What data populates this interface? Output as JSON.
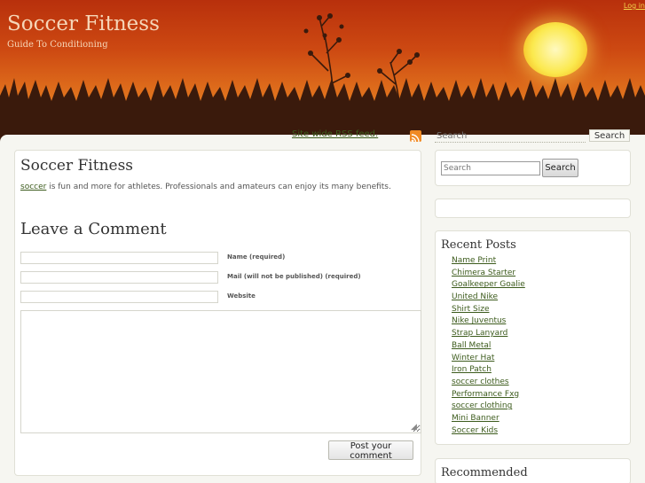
{
  "header": {
    "site_title": "Soccer Fitness",
    "tagline": "Guide To Conditioning",
    "login_link": "Log in"
  },
  "topbar": {
    "rss_label": "Site wide RSS feed.",
    "search_placeholder": "Search",
    "search_button": "Search"
  },
  "post": {
    "title": "Soccer Fitness",
    "link_text": "soccer",
    "text": " is fun and more for athletes.  Professionals and amateurs can enjoy its many benefits."
  },
  "comment_form": {
    "heading": "Leave a Comment",
    "name_label": "Name (required)",
    "mail_label": "Mail (will not be published) (required)",
    "website_label": "Website",
    "submit_label": "Post your comment"
  },
  "sidebar": {
    "search_placeholder": "Search",
    "search_button": "Search",
    "recent_heading": "Recent Posts",
    "recent_posts": [
      "Name Print",
      "Chimera Starter",
      "Goalkeeper Goalie",
      "United Nike",
      "Shirt Size",
      "Nike Juventus",
      "Strap Lanyard",
      "Ball Metal",
      "Winter Hat",
      "Iron Patch",
      "soccer clothes",
      "Performance Fxg",
      "soccer clothing",
      "Mini Banner",
      "Soccer Kids"
    ],
    "recommended_heading": "Recommended"
  },
  "colors": {
    "header_top": "#b8300c",
    "header_bottom": "#e98a28",
    "link": "#3c5b1c",
    "sun": "#fbe94e"
  }
}
